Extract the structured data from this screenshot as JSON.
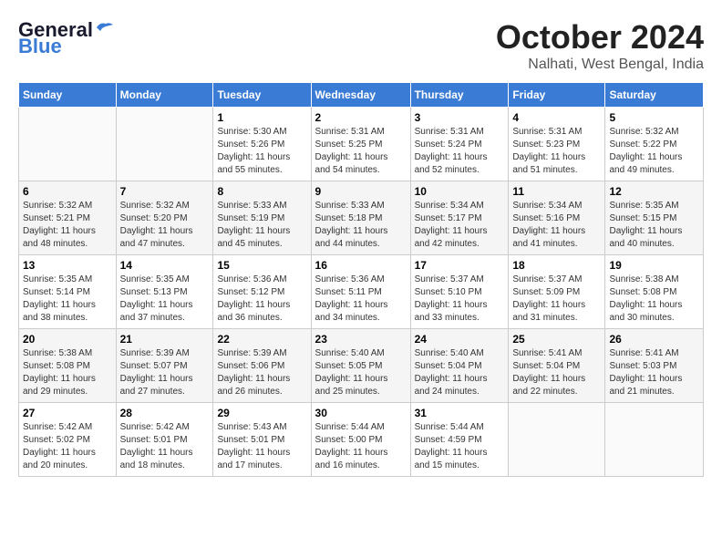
{
  "logo": {
    "line1": "General",
    "line2": "Blue"
  },
  "title": "October 2024",
  "location": "Nalhati, West Bengal, India",
  "days_of_week": [
    "Sunday",
    "Monday",
    "Tuesday",
    "Wednesday",
    "Thursday",
    "Friday",
    "Saturday"
  ],
  "weeks": [
    [
      {
        "day": "",
        "info": ""
      },
      {
        "day": "",
        "info": ""
      },
      {
        "day": "1",
        "info": "Sunrise: 5:30 AM\nSunset: 5:26 PM\nDaylight: 11 hours\nand 55 minutes."
      },
      {
        "day": "2",
        "info": "Sunrise: 5:31 AM\nSunset: 5:25 PM\nDaylight: 11 hours\nand 54 minutes."
      },
      {
        "day": "3",
        "info": "Sunrise: 5:31 AM\nSunset: 5:24 PM\nDaylight: 11 hours\nand 52 minutes."
      },
      {
        "day": "4",
        "info": "Sunrise: 5:31 AM\nSunset: 5:23 PM\nDaylight: 11 hours\nand 51 minutes."
      },
      {
        "day": "5",
        "info": "Sunrise: 5:32 AM\nSunset: 5:22 PM\nDaylight: 11 hours\nand 49 minutes."
      }
    ],
    [
      {
        "day": "6",
        "info": "Sunrise: 5:32 AM\nSunset: 5:21 PM\nDaylight: 11 hours\nand 48 minutes."
      },
      {
        "day": "7",
        "info": "Sunrise: 5:32 AM\nSunset: 5:20 PM\nDaylight: 11 hours\nand 47 minutes."
      },
      {
        "day": "8",
        "info": "Sunrise: 5:33 AM\nSunset: 5:19 PM\nDaylight: 11 hours\nand 45 minutes."
      },
      {
        "day": "9",
        "info": "Sunrise: 5:33 AM\nSunset: 5:18 PM\nDaylight: 11 hours\nand 44 minutes."
      },
      {
        "day": "10",
        "info": "Sunrise: 5:34 AM\nSunset: 5:17 PM\nDaylight: 11 hours\nand 42 minutes."
      },
      {
        "day": "11",
        "info": "Sunrise: 5:34 AM\nSunset: 5:16 PM\nDaylight: 11 hours\nand 41 minutes."
      },
      {
        "day": "12",
        "info": "Sunrise: 5:35 AM\nSunset: 5:15 PM\nDaylight: 11 hours\nand 40 minutes."
      }
    ],
    [
      {
        "day": "13",
        "info": "Sunrise: 5:35 AM\nSunset: 5:14 PM\nDaylight: 11 hours\nand 38 minutes."
      },
      {
        "day": "14",
        "info": "Sunrise: 5:35 AM\nSunset: 5:13 PM\nDaylight: 11 hours\nand 37 minutes."
      },
      {
        "day": "15",
        "info": "Sunrise: 5:36 AM\nSunset: 5:12 PM\nDaylight: 11 hours\nand 36 minutes."
      },
      {
        "day": "16",
        "info": "Sunrise: 5:36 AM\nSunset: 5:11 PM\nDaylight: 11 hours\nand 34 minutes."
      },
      {
        "day": "17",
        "info": "Sunrise: 5:37 AM\nSunset: 5:10 PM\nDaylight: 11 hours\nand 33 minutes."
      },
      {
        "day": "18",
        "info": "Sunrise: 5:37 AM\nSunset: 5:09 PM\nDaylight: 11 hours\nand 31 minutes."
      },
      {
        "day": "19",
        "info": "Sunrise: 5:38 AM\nSunset: 5:08 PM\nDaylight: 11 hours\nand 30 minutes."
      }
    ],
    [
      {
        "day": "20",
        "info": "Sunrise: 5:38 AM\nSunset: 5:08 PM\nDaylight: 11 hours\nand 29 minutes."
      },
      {
        "day": "21",
        "info": "Sunrise: 5:39 AM\nSunset: 5:07 PM\nDaylight: 11 hours\nand 27 minutes."
      },
      {
        "day": "22",
        "info": "Sunrise: 5:39 AM\nSunset: 5:06 PM\nDaylight: 11 hours\nand 26 minutes."
      },
      {
        "day": "23",
        "info": "Sunrise: 5:40 AM\nSunset: 5:05 PM\nDaylight: 11 hours\nand 25 minutes."
      },
      {
        "day": "24",
        "info": "Sunrise: 5:40 AM\nSunset: 5:04 PM\nDaylight: 11 hours\nand 24 minutes."
      },
      {
        "day": "25",
        "info": "Sunrise: 5:41 AM\nSunset: 5:04 PM\nDaylight: 11 hours\nand 22 minutes."
      },
      {
        "day": "26",
        "info": "Sunrise: 5:41 AM\nSunset: 5:03 PM\nDaylight: 11 hours\nand 21 minutes."
      }
    ],
    [
      {
        "day": "27",
        "info": "Sunrise: 5:42 AM\nSunset: 5:02 PM\nDaylight: 11 hours\nand 20 minutes."
      },
      {
        "day": "28",
        "info": "Sunrise: 5:42 AM\nSunset: 5:01 PM\nDaylight: 11 hours\nand 18 minutes."
      },
      {
        "day": "29",
        "info": "Sunrise: 5:43 AM\nSunset: 5:01 PM\nDaylight: 11 hours\nand 17 minutes."
      },
      {
        "day": "30",
        "info": "Sunrise: 5:44 AM\nSunset: 5:00 PM\nDaylight: 11 hours\nand 16 minutes."
      },
      {
        "day": "31",
        "info": "Sunrise: 5:44 AM\nSunset: 4:59 PM\nDaylight: 11 hours\nand 15 minutes."
      },
      {
        "day": "",
        "info": ""
      },
      {
        "day": "",
        "info": ""
      }
    ]
  ]
}
